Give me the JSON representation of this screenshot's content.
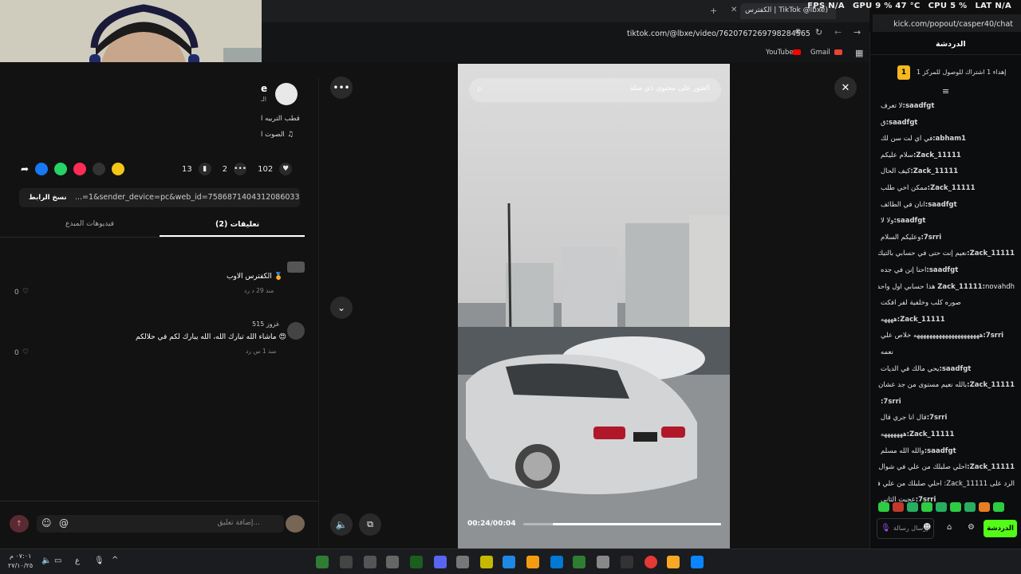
{
  "browser": {
    "tab_title": "الكفترس | TikTok @lbxe)",
    "url": "tiktok.com/@lbxe/video/7620767269798284565",
    "bookmark_youtube": "YouTube",
    "bookmark_gmail": "Gmail",
    "popout_url": "kick.com/popout/casper40/chat"
  },
  "stats_overlay": {
    "fps": "FPS N/A",
    "gpu": "GPU 9 % 47 °C",
    "cpu": "CPU 5 %",
    "lat": "LAT N/A"
  },
  "tiktok": {
    "author_initial": "e",
    "author_sub": "الـ",
    "caption": "قطب التربيه ا",
    "sound": "الصوت ا",
    "likes": "102",
    "comments_count": "2",
    "saves": "13",
    "copy_link_label": "نسخ الرابط",
    "link_value": "...=1&sender_device=pc&web_id=7586871404312086033",
    "tab_comments": "تعليقات (2)",
    "tab_creator_videos": "فيديوهات المبدع",
    "comments": [
      {
        "text": "الكفترس الاوب 🏅",
        "meta": "منذ 29 د   رد",
        "likes": "0"
      },
      {
        "author": "غزوز 515",
        "text": "ماشاء الله تبارك الله، الله يبارك لكم في حلالكم 😍",
        "meta": "منذ 1 س   رد",
        "likes": "0"
      }
    ],
    "comment_placeholder": "إضافة تعليق...",
    "search_placeholder": "العثور على محتوى ذي صلة",
    "time": "00:24/00:04",
    "progress": 0.85
  },
  "chat": {
    "title": "الدردشة",
    "pinned": "إهداء 1 اشتراك للوصول للمركز 1",
    "badge": "1",
    "messages": [
      {
        "user": "saadfgt:",
        "text": "لا تعرف"
      },
      {
        "user": "saadfgt:",
        "text": "ق"
      },
      {
        "user": "abham1:",
        "text": "في اي لت سن لك"
      },
      {
        "user": "Zack_11111:",
        "text": "سلام عليكم"
      },
      {
        "user": "Zack_11111:",
        "text": "كيف الحال"
      },
      {
        "user": "Zack_11111:",
        "text": "ممكن اخي طلب"
      },
      {
        "user": "saadfgt:",
        "text": "انان في الطائف"
      },
      {
        "user": "saadfgt:",
        "text": "ولا لا"
      },
      {
        "user": "7srri:",
        "text": "وعليكم السلام"
      },
      {
        "user": "Zack_11111:",
        "text": "نعيم إنت حتى في حسابي بالتيك توك"
      },
      {
        "user": "saadfgt:",
        "text": "احنا إنن في جده"
      },
      {
        "user": "Zack_11111:",
        "text": "novahdh هذا حسابي اول واحد فيه"
      },
      {
        "user": "",
        "text": "صوره كلب وخلفية لفر افكت"
      },
      {
        "user": "Zack_11111:",
        "text": "ههههه"
      },
      {
        "user": "7srri:",
        "text": "هههههههههههههههههههههه خلاص علي"
      },
      {
        "user": "",
        "text": "نعمه"
      },
      {
        "user": "saadfgt:",
        "text": "يحي مالك في الديات"
      },
      {
        "user": "Zack_11111:",
        "text": "بالله نعيم مستوى من جد عشان احسن"
      },
      {
        "user": "7srri:",
        "text": ""
      },
      {
        "user": "7srri:",
        "text": "قال انا جري قال"
      },
      {
        "user": "Zack_11111:",
        "text": "هههههههه"
      },
      {
        "user": "saadfgt:",
        "text": "والله الله مسلم"
      },
      {
        "user": "Zack_11111:",
        "text": "احلي صلبلك من علي في شوال"
      },
      {
        "user": "",
        "text": "الرد على Zack_11111: احلي صلبلك من علي في شوال"
      },
      {
        "user": "7srri:",
        "text": "عجبت الثاني"
      }
    ],
    "send_placeholder": "إرسال رسالة",
    "chat_button": "الدردشة"
  },
  "taskbar": {
    "time": "٠٧:٠١ م",
    "date": "٢٧/١٠/٢٥",
    "lang": "ع"
  },
  "colors": {
    "kick_green": "#53fc18",
    "tiktok_red": "#fe2c55",
    "chrome_dark": "#1d1e20"
  }
}
